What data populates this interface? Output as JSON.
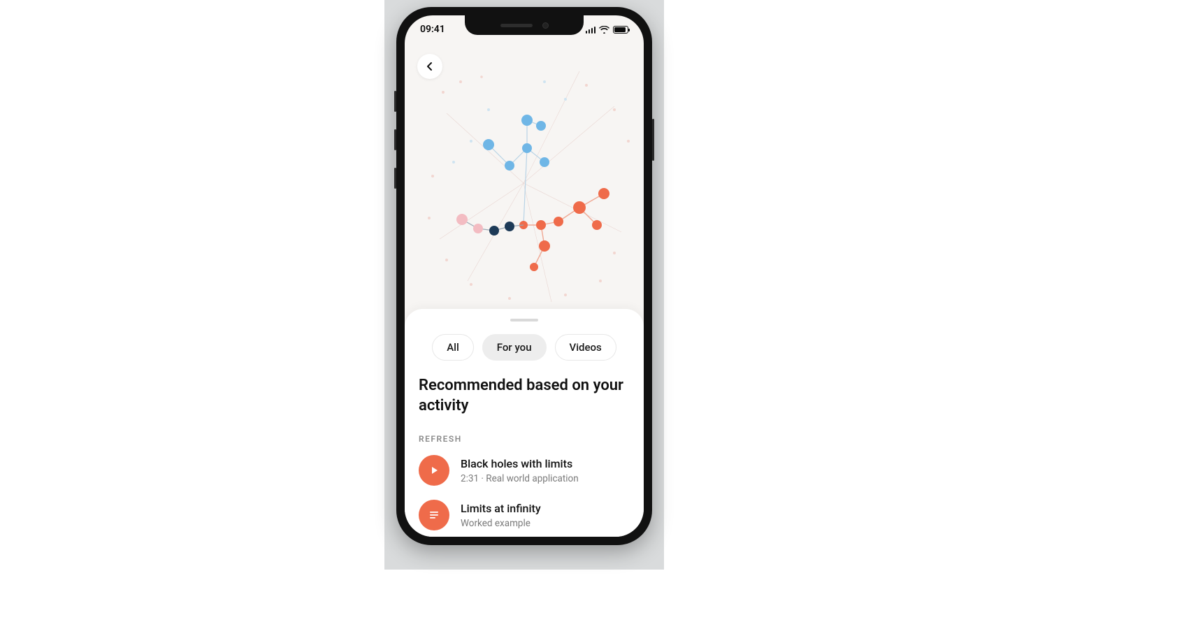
{
  "statusbar": {
    "time": "09:41"
  },
  "tabs": [
    {
      "label": "All",
      "active": false
    },
    {
      "label": "For you",
      "active": true
    },
    {
      "label": "Videos",
      "active": false
    }
  ],
  "section": {
    "title": "Recommended based on your activity",
    "refresh_label": "REFRESH"
  },
  "items": [
    {
      "title": "Black holes with limits",
      "subtitle": "2:31 · Real world application",
      "icon": "play"
    },
    {
      "title": "Limits at infinity",
      "subtitle": "Worked example",
      "icon": "doc"
    }
  ],
  "colors": {
    "accent": "#ef6b4a",
    "blue": "#6fb6e6",
    "navy": "#1d3a57",
    "pink": "#f3bcc2"
  }
}
